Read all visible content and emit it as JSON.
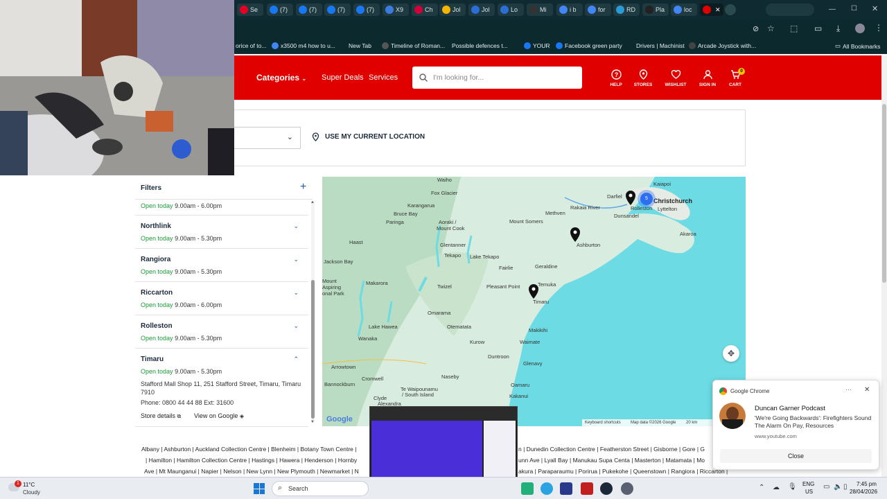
{
  "browser": {
    "tabs": [
      {
        "label": "Se",
        "color": "#e60023"
      },
      {
        "label": "(7)",
        "color": "#1877f2"
      },
      {
        "label": "(7)",
        "color": "#1877f2"
      },
      {
        "label": "(7)",
        "color": "#1877f2"
      },
      {
        "label": "(7)",
        "color": "#1877f2"
      },
      {
        "label": "X9",
        "color": "#3b7be0"
      },
      {
        "label": "Ch",
        "color": "#d0003a"
      },
      {
        "label": "Jol",
        "color": "#f4b400"
      },
      {
        "label": "Jol",
        "color": "#2b6fd6"
      },
      {
        "label": "Lo",
        "color": "#2b6fd6"
      },
      {
        "label": "Mi",
        "color": "#333"
      },
      {
        "label": "i b",
        "color": "#4285f4"
      },
      {
        "label": "for",
        "color": "#4285f4"
      },
      {
        "label": "RD",
        "color": "#2b9bd6"
      },
      {
        "label": "Pla",
        "color": "#222"
      },
      {
        "label": "loc",
        "color": "#4285f4"
      },
      {
        "label": "",
        "color": "#e00000"
      }
    ],
    "bookmarks": [
      {
        "label": "orice of to...",
        "color": ""
      },
      {
        "label": "x3500 m4 how to u...",
        "color": "#4285f4"
      },
      {
        "label": "New Tab",
        "color": ""
      },
      {
        "label": "Timeline of Roman...",
        "color": "#555"
      },
      {
        "label": "Possible defences t...",
        "color": ""
      },
      {
        "label": "YOUR",
        "color": "#1877f2"
      },
      {
        "label": "Facebook green party",
        "color": "#1877f2"
      },
      {
        "label": "Drivers | Machinist",
        "color": ""
      },
      {
        "label": "Arcade Joystick with...",
        "color": "#444"
      }
    ],
    "all_bookmarks": "All Bookmarks"
  },
  "header": {
    "categories": "Categories",
    "super_deals": "Super Deals",
    "services": "Services",
    "search_placeholder": "I'm looking for...",
    "icons": {
      "help": "HELP",
      "stores": "STORES",
      "wishlist": "WISHLIST",
      "signin": "SIGN IN",
      "cart": "CART",
      "cart_count": "0"
    }
  },
  "location": {
    "use_current": "USE MY CURRENT LOCATION"
  },
  "sidebar": {
    "filters": "Filters",
    "open_today": "Open today",
    "first_hours": "9.00am - 6.00pm",
    "stores": [
      {
        "name": "Northlink",
        "hours": "9.00am - 5.30pm"
      },
      {
        "name": "Rangiora",
        "hours": "9.00am - 5.30pm"
      },
      {
        "name": "Riccarton",
        "hours": "9.00am - 6.00pm"
      },
      {
        "name": "Rolleston",
        "hours": "9.00am - 5.30pm"
      },
      {
        "name": "Timaru",
        "hours": "9.00am - 5.30pm"
      }
    ],
    "timaru": {
      "address": "Stafford Mall Shop 11, 251 Stafford Street, Timaru, Timaru 7910",
      "phone": "Phone: 0800 44 44 88 Ext: 31600",
      "store_details": "Store details",
      "view_google": "View on Google"
    }
  },
  "map": {
    "cluster_count": "5",
    "places": {
      "kaiapoi": "Kaiapoi",
      "christchurch": "Christchurch",
      "lyttelton": "Lyttelton",
      "darfield": "Darfiel",
      "rolleston": "Rolleston",
      "dunsandel": "Dunsandel",
      "akaroa": "Akaroa",
      "methven": "Methven",
      "rakaia": "Rakaia River",
      "mount_somers": "Mount Somers",
      "ashburton": "Ashburton",
      "geraldine": "Geraldine",
      "pleasant_point": "Pleasant Point",
      "temuka": "Temuka",
      "timaru": "Timaru",
      "fairlie": "Fairlie",
      "lake_tekapo": "Lake Tekapo",
      "tekapo": "Tekapo",
      "glentanner": "Glentanner",
      "aoraki": "Aoraki /",
      "mount_cook": "Mount Cook",
      "fox": "Fox Glacier",
      "karangarua": "Karangarua",
      "bruce_bay": "Bruce Bay",
      "paringa": "Paringa",
      "haast": "Haast",
      "jackson_bay": "Jackson Bay",
      "makarora": "Makarora",
      "twizel": "Twizel",
      "omarama": "Omarama",
      "otematata": "Otematata",
      "lake_hawea": "Lake Hawea",
      "wanaka": "Wanaka",
      "makikihi": "Makikihi",
      "waimate": "Waimate",
      "kurow": "Kurow",
      "duntroon": "Duntroon",
      "glenavy": "Glenavy",
      "naseby": "Naseby",
      "oamaru": "Oamaru",
      "kakanui": "Kakanui",
      "arrowtown": "Arrowtown",
      "bannockburn": "Bannockburn",
      "cromwell": "Cromwell",
      "clyde": "Clyde",
      "alexandra": "Alexandra",
      "te_waipounamu": "Te Waipounamu",
      "south_island": "/ South Island",
      "mount": "Mount",
      "aspiring": "Aspiring",
      "onal_park": "onal Park",
      "waiho": "Waiho"
    },
    "google": "Google",
    "keyboard": "Keyboard shortcuts",
    "mapdata": "Map data ©2026 Google",
    "scale": "20 km"
  },
  "footer": {
    "line1a": "Albany | Ashburton | Auckland Collection Centre | Blenheim | Botany Town Centre |",
    "line1b": "n | Dunedin Collection Centre | Featherston Street | Gisborne | Gore | G",
    "line2a": "| Hamilton | Hamilton Collection Centre | Hastings | Hawera | Henderson | Hornby",
    "line2b": "unn Ave | Lyall Bay | Manukau Supa Centa | Masterton | Matamata | Mo",
    "line3a": "Ave | Mt Maunganui | Napier | Nelson | New Lynn | New Plymouth | Newmarket | N",
    "line3b": "akura | Paraparaumu | Porirua | Pukekohe | Queenstown | Rangiora | Riccarton |"
  },
  "notification": {
    "app": "Google Chrome",
    "title": "Duncan Garner Podcast",
    "body": "'We're Going Backwards': Firefighters Sound The Alarm On Pay, Resources",
    "source": "www.youtube.com",
    "close": "Close"
  },
  "taskbar": {
    "weather_temp": "11°C",
    "weather_desc": "Cloudy",
    "weather_badge": "1",
    "search": "Search",
    "lang": "ENG",
    "region": "US",
    "time": "7:45 pm",
    "date": "28/04/2026"
  },
  "colors": {
    "brand_red": "#e00000",
    "open_green": "#1a9a3a",
    "link_blue": "#1a5bb5",
    "sea": "#6ddbe3"
  }
}
